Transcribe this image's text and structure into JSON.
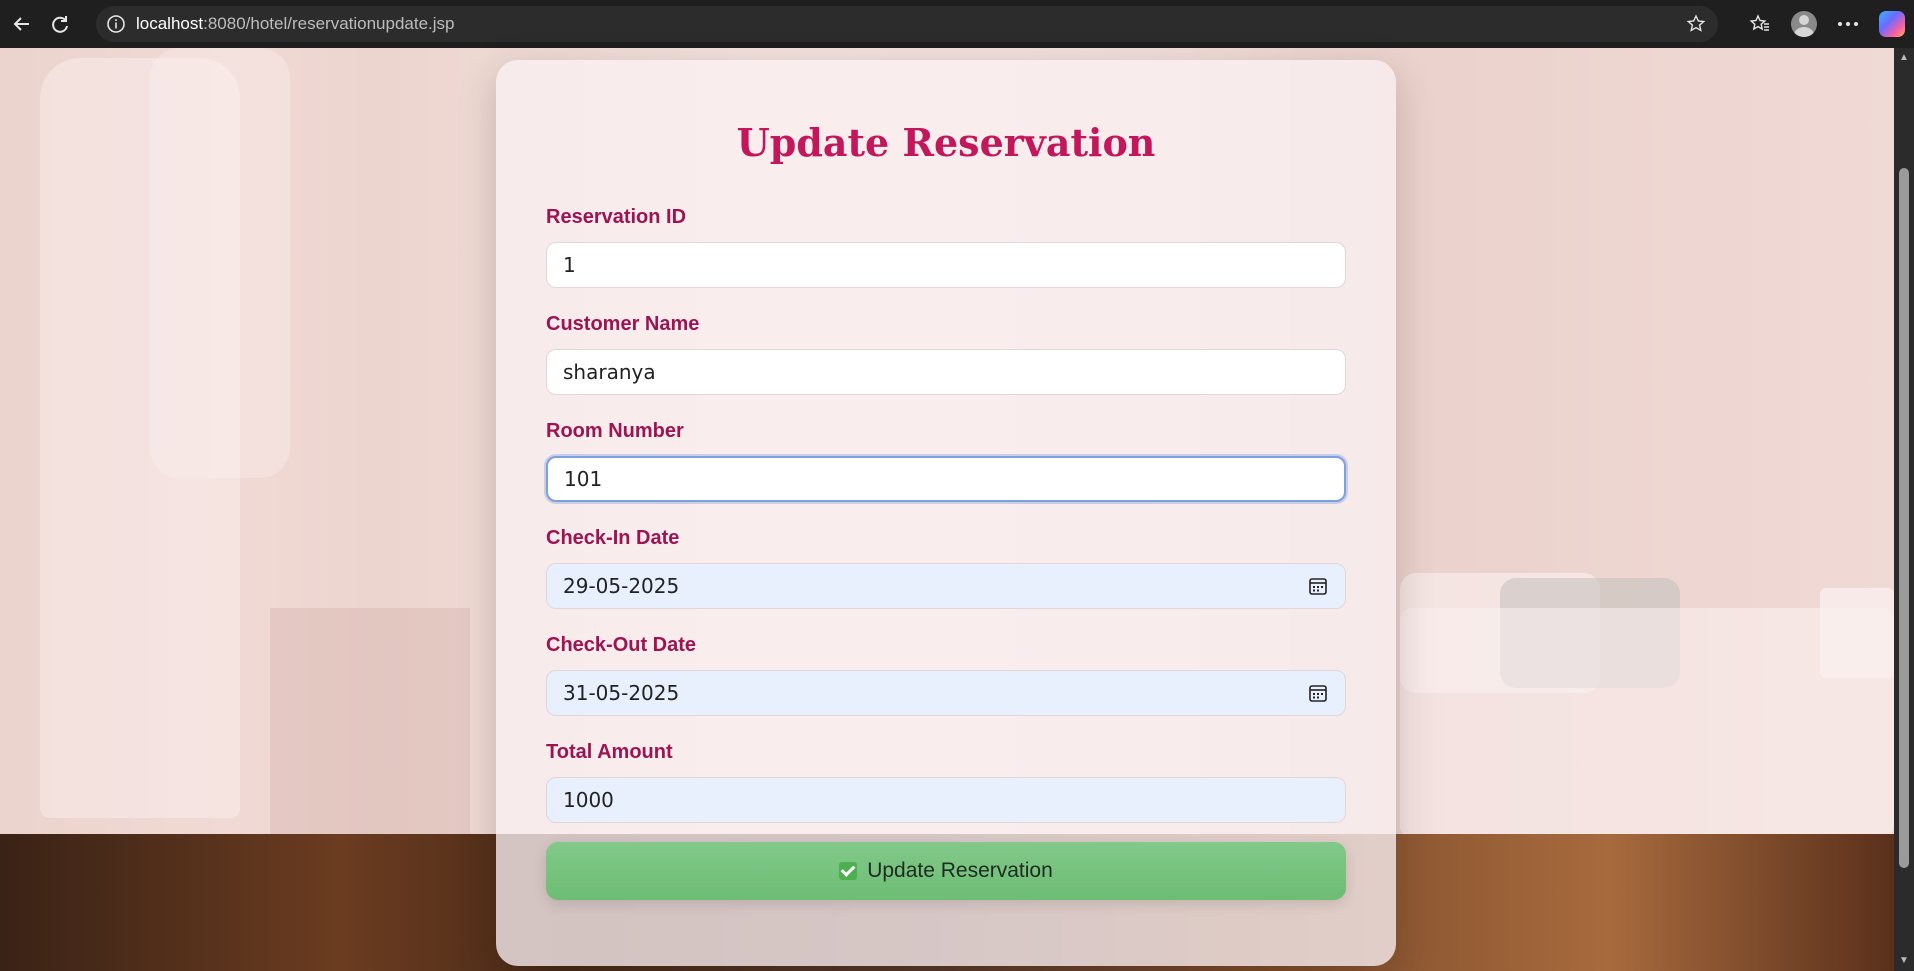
{
  "browser": {
    "url_host": "localhost",
    "url_rest": ":8080/hotel/reservationupdate.jsp"
  },
  "form": {
    "title": "Update Reservation",
    "fields": {
      "reservation_id": {
        "label": "Reservation ID",
        "value": "1"
      },
      "customer_name": {
        "label": "Customer Name",
        "value": "sharanya"
      },
      "room_number": {
        "label": "Room Number",
        "value": "101"
      },
      "check_in": {
        "label": "Check-In Date",
        "value": "29-05-2025"
      },
      "check_out": {
        "label": "Check-Out Date",
        "value": "31-05-2025"
      },
      "total_amount": {
        "label": "Total Amount",
        "value": "1000"
      }
    },
    "submit_label": "Update Reservation"
  },
  "colors": {
    "title": "#c2185b",
    "label": "#9c1452",
    "button": "#6dbd73"
  }
}
